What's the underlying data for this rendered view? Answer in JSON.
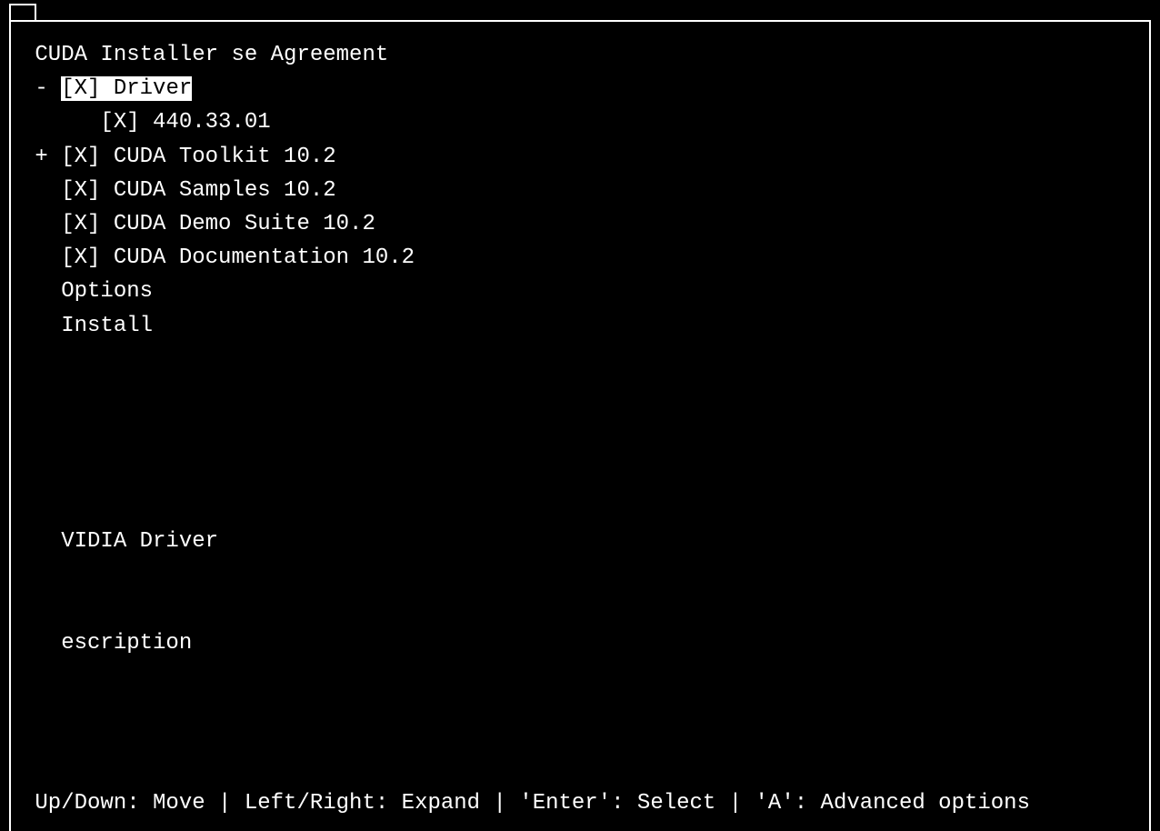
{
  "title": " CUDA Installer se Agreement",
  "items": [
    {
      "prefix": " - ",
      "check": "[X]",
      "gap": " ",
      "label": "Driver",
      "selected": true,
      "indent": ""
    },
    {
      "prefix": "      ",
      "check": "[X]",
      "gap": " ",
      "label": "440.33.01",
      "selected": false,
      "indent": ""
    },
    {
      "prefix": " + ",
      "check": "[X]",
      "gap": " ",
      "label": "CUDA Toolkit 10.2",
      "selected": false,
      "indent": ""
    },
    {
      "prefix": "   ",
      "check": "[X]",
      "gap": " ",
      "label": "CUDA Samples 10.2",
      "selected": false,
      "indent": ""
    },
    {
      "prefix": "   ",
      "check": "[X]",
      "gap": " ",
      "label": "CUDA Demo Suite 10.2",
      "selected": false,
      "indent": ""
    },
    {
      "prefix": "   ",
      "check": "[X]",
      "gap": " ",
      "label": "CUDA Documentation 10.2",
      "selected": false,
      "indent": ""
    },
    {
      "prefix": "   ",
      "check": "",
      "gap": "",
      "label": "Options",
      "selected": false,
      "indent": ""
    },
    {
      "prefix": "   ",
      "check": "",
      "gap": "",
      "label": "Install",
      "selected": false,
      "indent": ""
    }
  ],
  "info_line": "   VIDIA Driver",
  "desc_line": "   escription",
  "footer": " Up/Down: Move | Left/Right: Expand | 'Enter': Select | 'A': Advanced options"
}
